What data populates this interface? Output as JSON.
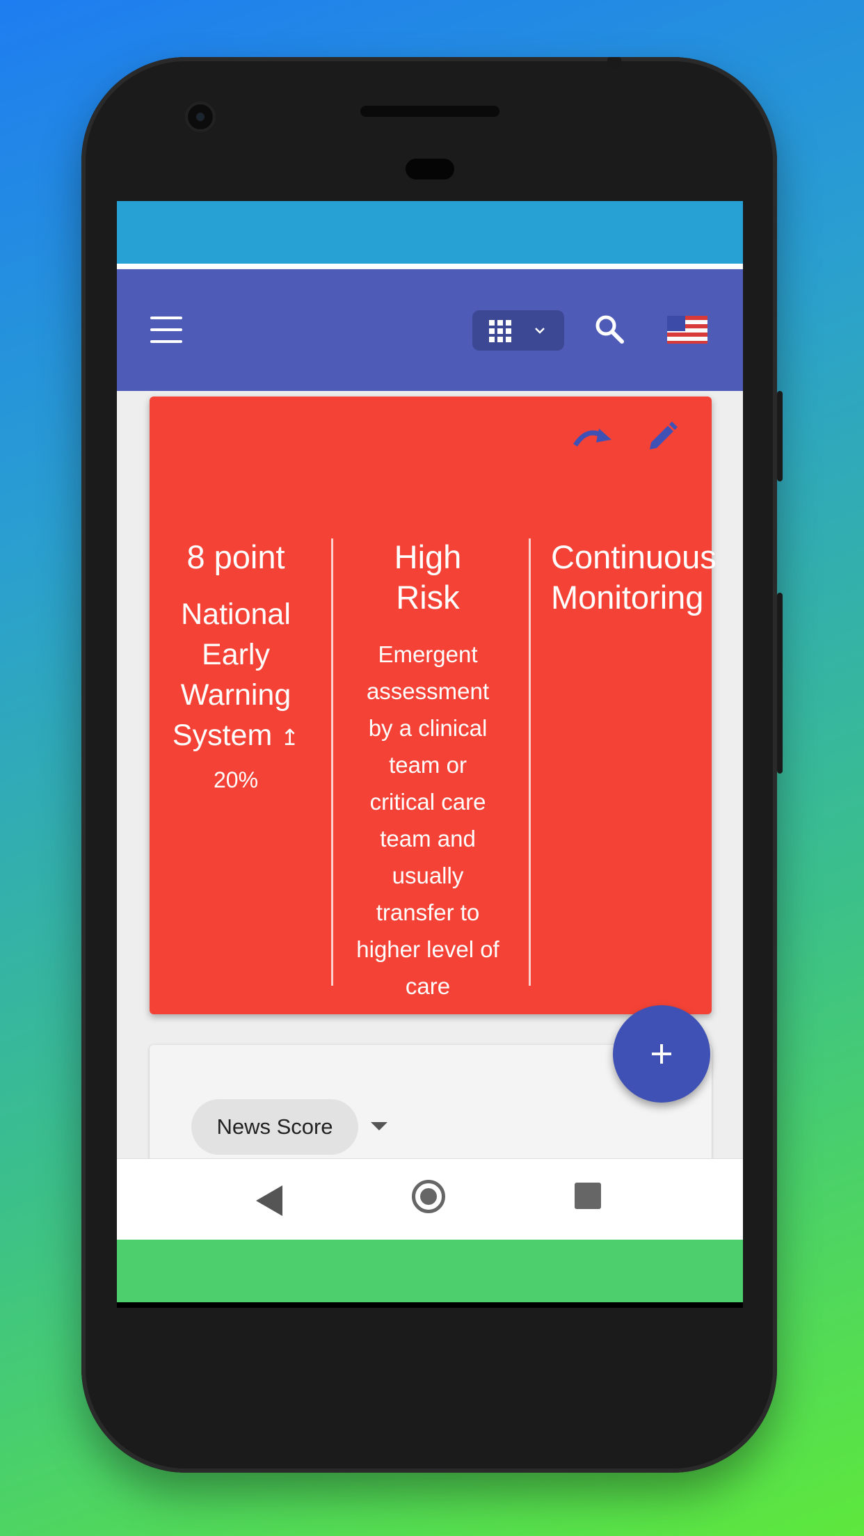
{
  "appbar": {
    "menu_icon": "menu-icon",
    "app_switcher_icon": "grid-icon",
    "search_icon": "search-icon",
    "language_flag": "us-flag-icon"
  },
  "alert_card": {
    "color": "#f44336",
    "actions": [
      "redo-icon",
      "edit-icon"
    ],
    "score": {
      "title": "8 point",
      "subtitle": "National Early Warning System",
      "trend_arrow": "↥",
      "trend_value": "20%"
    },
    "risk": {
      "title": "High Risk",
      "description": "Emergent assessment by a clinical team or critical care team and usually transfer to higher level of care"
    },
    "monitoring": {
      "title": "Continuous Monitoring"
    }
  },
  "filter_card": {
    "chip_label": "News Score"
  },
  "fab": {
    "icon": "plus-icon",
    "color": "#3f51b5"
  },
  "colors": {
    "appbar": "#4e5cb8",
    "statusbar": "#27a0d4"
  }
}
